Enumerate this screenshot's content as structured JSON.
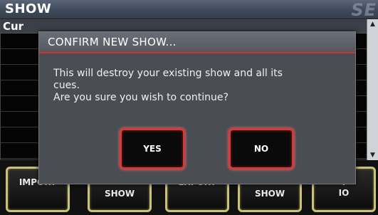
{
  "window": {
    "title": "SHOW",
    "logo": "SE"
  },
  "list": {
    "column_header": "Cur"
  },
  "function_buttons": [
    {
      "label": "IMPORT"
    },
    {
      "label": "SHOW"
    },
    {
      "label": "EXPORT"
    },
    {
      "label": "SHOW"
    },
    {
      "label": "T\nIO"
    }
  ],
  "dialog": {
    "title": "CONFIRM NEW SHOW...",
    "message_line1": "This will destroy your existing show and all its",
    "message_line2": "cues.",
    "message_line3": "Are you sure you wish to continue?",
    "yes_label": "YES",
    "no_label": "NO"
  },
  "colors": {
    "accent_red": "#d33a3a",
    "button_border": "#c9c27a"
  }
}
